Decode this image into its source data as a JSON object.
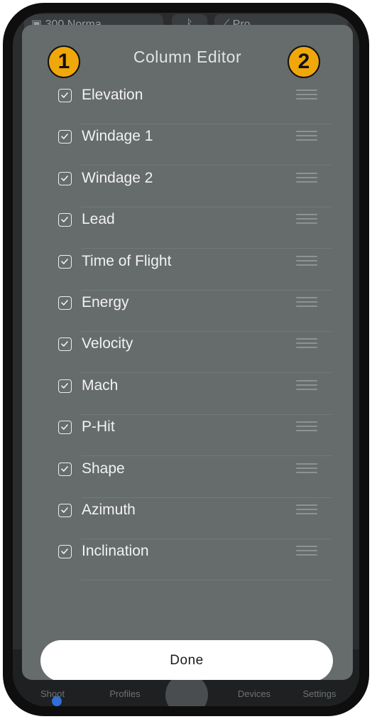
{
  "background": {
    "profile": "300 Norma",
    "bluetooth_icon": "bluetooth-icon",
    "mode": "Pro",
    "tabs": [
      "Shoot",
      "Profiles",
      "Devices",
      "Settings"
    ]
  },
  "sheet": {
    "title": "Column Editor",
    "annotations": [
      "1",
      "2"
    ],
    "items": [
      {
        "label": "Elevation",
        "checked": true
      },
      {
        "label": "Windage 1",
        "checked": true
      },
      {
        "label": "Windage 2",
        "checked": true
      },
      {
        "label": "Lead",
        "checked": true
      },
      {
        "label": "Time of Flight",
        "checked": true
      },
      {
        "label": "Energy",
        "checked": true
      },
      {
        "label": "Velocity",
        "checked": true
      },
      {
        "label": "Mach",
        "checked": true
      },
      {
        "label": "P-Hit",
        "checked": true
      },
      {
        "label": "Shape",
        "checked": true
      },
      {
        "label": "Azimuth",
        "checked": true
      },
      {
        "label": "Inclination",
        "checked": true
      }
    ],
    "done_label": "Done"
  },
  "colors": {
    "sheet": "#666b6b",
    "badge": "#f0a70a",
    "done_button": "#ffffff"
  }
}
